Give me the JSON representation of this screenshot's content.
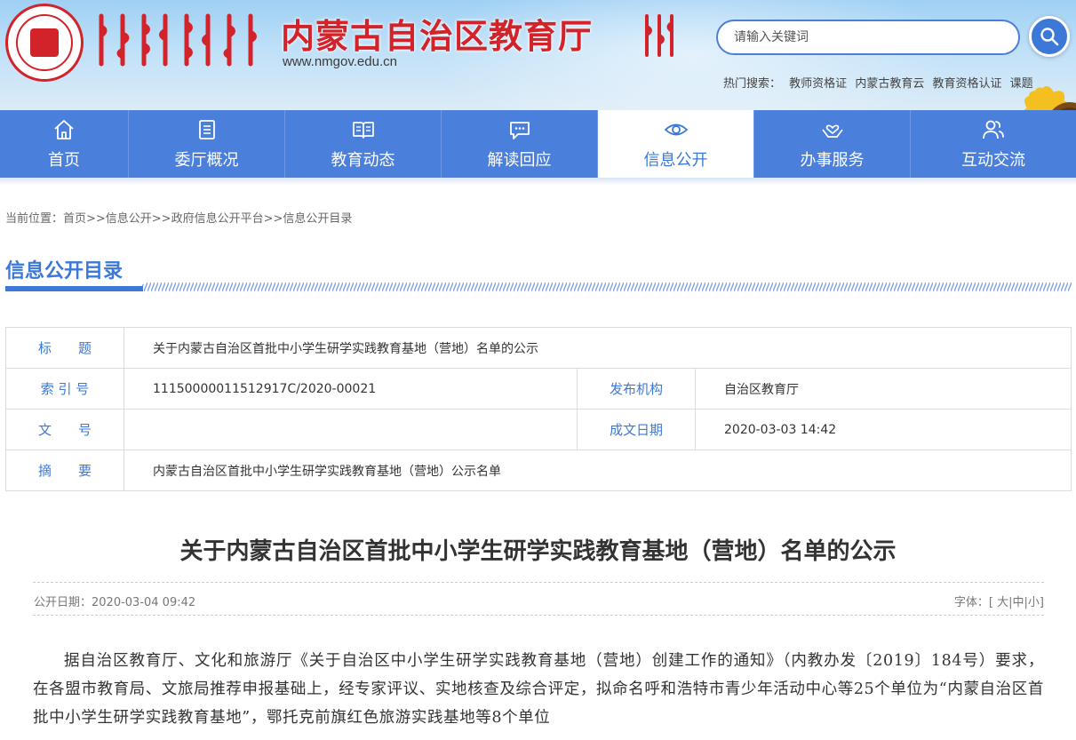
{
  "header": {
    "site_title": "内蒙古自治区教育厅",
    "site_url": "www.nmgov.edu.cn",
    "search_placeholder": "请输入关键词",
    "hot_search_label": "热门搜索：",
    "hot_search_items": [
      "教师资格证",
      "内蒙古教育云",
      "教育资格认证",
      "课题"
    ]
  },
  "nav": {
    "items": [
      {
        "label": "首页",
        "icon": "home-icon"
      },
      {
        "label": "委厅概况",
        "icon": "document-list-icon"
      },
      {
        "label": "教育动态",
        "icon": "open-book-icon"
      },
      {
        "label": "解读回应",
        "icon": "chat-bubble-icon"
      },
      {
        "label": "信息公开",
        "icon": "eye-icon",
        "active": true
      },
      {
        "label": "办事服务",
        "icon": "hands-heart-icon"
      },
      {
        "label": "互动交流",
        "icon": "people-icon"
      }
    ]
  },
  "breadcrumb": "当前位置：首页>>信息公开>>政府信息公开平台>>信息公开目录",
  "section_title": "信息公开目录",
  "meta": {
    "title_label": "标　　题",
    "title_value": "关于内蒙古自治区首批中小学生研学实践教育基地（营地）名单的公示",
    "index_label": "索 引 号",
    "index_value": "11150000011512917C/2020-00021",
    "publisher_label": "发布机构",
    "publisher_value": "自治区教育厅",
    "doc_no_label": "文　　号",
    "doc_no_value": "",
    "created_label": "成文日期",
    "created_value": "2020-03-03 14:42",
    "summary_label": "摘　　要",
    "summary_value": "内蒙古自治区首批中小学生研学实践教育基地（营地）公示名单"
  },
  "article": {
    "title": "关于内蒙古自治区首批中小学生研学实践教育基地（营地）名单的公示",
    "pub_date": "公开日期：2020-03-04 09:42",
    "font_size_label": "字体：[",
    "font_large": "大",
    "font_medium": "中",
    "font_small": "小",
    "body": "据自治区教育厅、文化和旅游厅《关于自治区中小学生研学实践教育基地（营地）创建工作的通知》（内教办发〔2019〕184号）要求，在各盟市教育局、文旅局推荐申报基础上，经专家评议、实地核查及综合评定，拟命名呼和浩特市青少年活动中心等25个单位为“内蒙自治区首批中小学生研学实践教育基地”，鄂托克前旗红色旅游实践基地等8个单位"
  },
  "colors": {
    "nav_bg": "#4a7fdb",
    "accent_blue": "#3c78d8",
    "title_red": "#d2232a"
  }
}
